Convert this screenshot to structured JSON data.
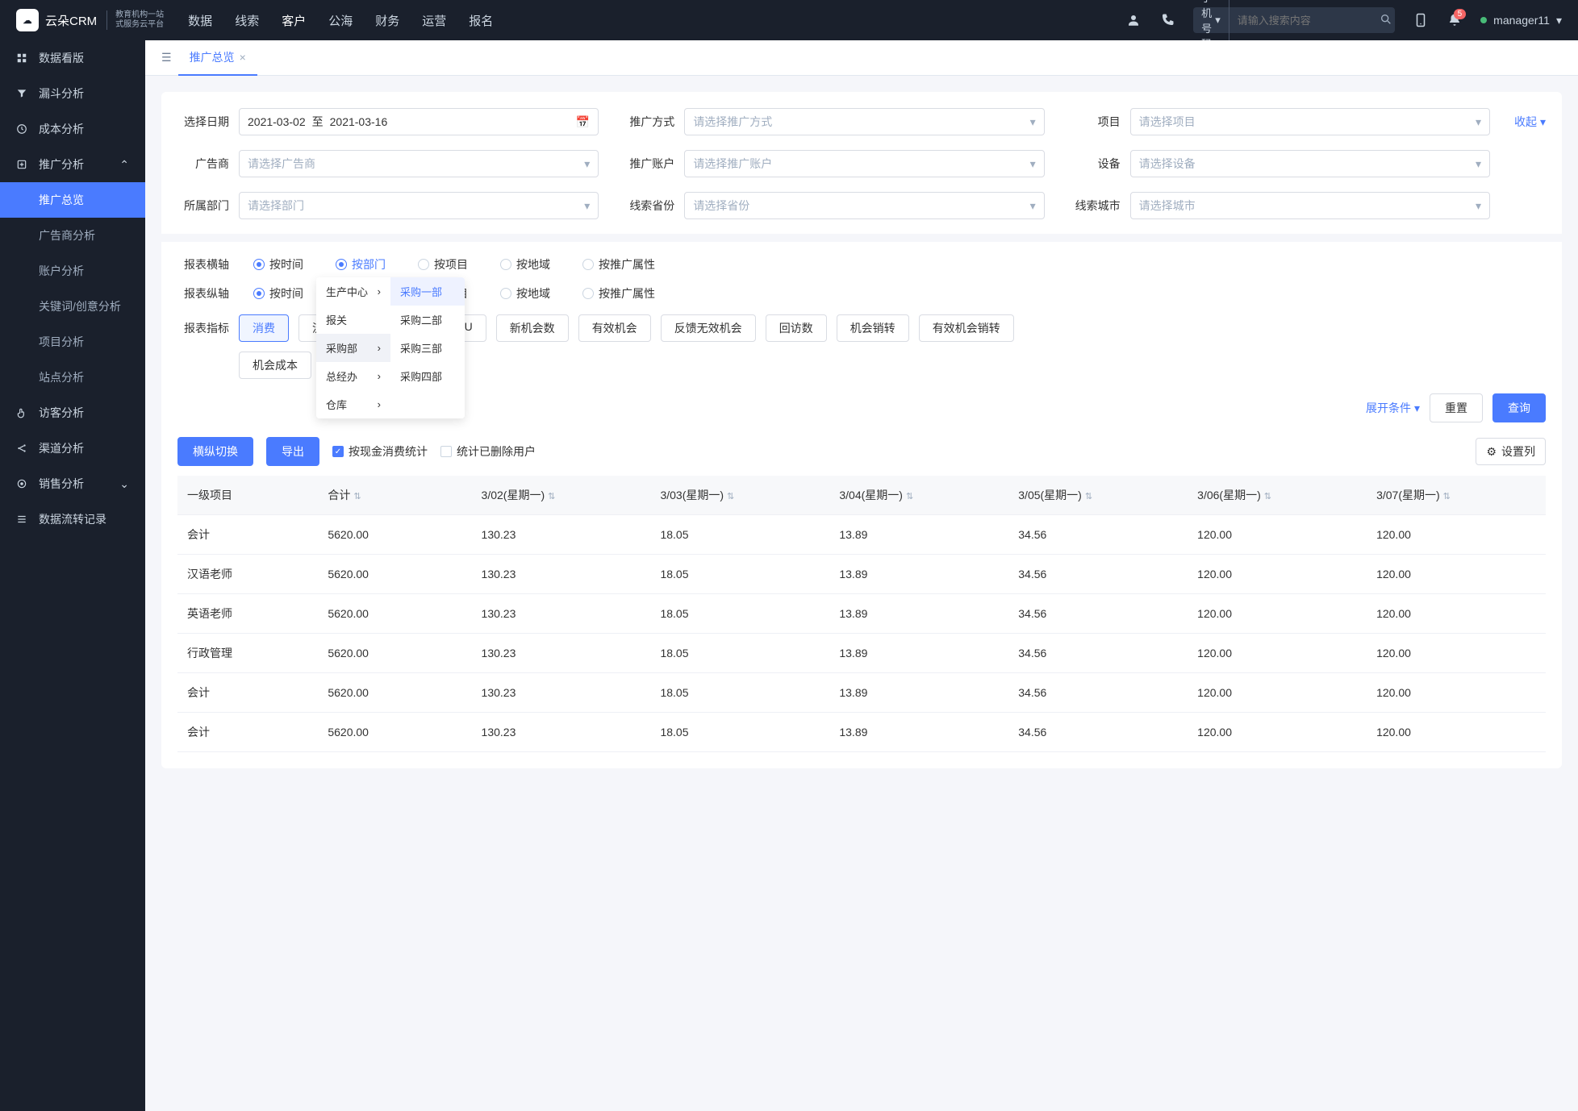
{
  "logo": {
    "brand": "云朵CRM",
    "tagline_l1": "教育机构一站",
    "tagline_l2": "式服务云平台"
  },
  "topnav": {
    "items": [
      "数据",
      "线索",
      "客户",
      "公海",
      "财务",
      "运营",
      "报名"
    ],
    "active": "客户",
    "search_type": "手机号码",
    "search_placeholder": "请输入搜索内容",
    "bell_badge": "5",
    "username": "manager11"
  },
  "sidebar": [
    {
      "icon": "grid",
      "label": "数据看版"
    },
    {
      "icon": "funnel",
      "label": "漏斗分析"
    },
    {
      "icon": "clock",
      "label": "成本分析"
    },
    {
      "icon": "share",
      "label": "推广分析",
      "expanded": true,
      "children": [
        {
          "label": "推广总览",
          "active": true
        },
        {
          "label": "广告商分析"
        },
        {
          "label": "账户分析"
        },
        {
          "label": "关键词/创意分析"
        },
        {
          "label": "项目分析"
        },
        {
          "label": "站点分析"
        }
      ]
    },
    {
      "icon": "hand",
      "label": "访客分析"
    },
    {
      "icon": "share2",
      "label": "渠道分析"
    },
    {
      "icon": "target",
      "label": "销售分析",
      "expand_icon": true
    },
    {
      "icon": "menu",
      "label": "数据流转记录"
    }
  ],
  "tab": {
    "title": "推广总览"
  },
  "filters": {
    "date_label": "选择日期",
    "date_from": "2021-03-02",
    "date_to": "2021-03-16",
    "date_sep": "至",
    "way_label": "推广方式",
    "way_placeholder": "请选择推广方式",
    "project_label": "项目",
    "project_placeholder": "请选择项目",
    "advertiser_label": "广告商",
    "advertiser_placeholder": "请选择广告商",
    "account_label": "推广账户",
    "account_placeholder": "请选择推广账户",
    "device_label": "设备",
    "device_placeholder": "请选择设备",
    "dept_label": "所属部门",
    "dept_placeholder": "请选择部门",
    "province_label": "线索省份",
    "province_placeholder": "请选择省份",
    "city_label": "线索城市",
    "city_placeholder": "请选择城市",
    "collapse": "收起"
  },
  "axis_rows": {
    "h_label": "报表横轴",
    "v_label": "报表纵轴",
    "options": [
      "按时间",
      "按部门",
      "按项目",
      "按地域",
      "按推广属性"
    ],
    "h_selected": "按时间",
    "h_hover": "按部门",
    "v_selected": "按时间"
  },
  "dept_dropdown": {
    "level1": [
      {
        "label": "生产中心",
        "arrow": true
      },
      {
        "label": "报关"
      },
      {
        "label": "采购部",
        "arrow": true,
        "hovered": true
      },
      {
        "label": "总经办",
        "arrow": true
      },
      {
        "label": "仓库",
        "arrow": true
      }
    ],
    "level2": [
      {
        "label": "采购一部",
        "sel": true
      },
      {
        "label": "采购二部"
      },
      {
        "label": "采购三部"
      },
      {
        "label": "采购四部"
      }
    ]
  },
  "metrics": {
    "label": "报表指标",
    "row1": [
      "消费",
      "流",
      "",
      "",
      "ARPU",
      "新机会数",
      "有效机会",
      "反馈无效机会",
      "回访数",
      "机会销转",
      "有效机会销转"
    ],
    "row2": [
      "机会成本",
      ""
    ],
    "selected": "消费"
  },
  "actions": {
    "expand": "展开条件",
    "reset": "重置",
    "query": "查询"
  },
  "table_toolbar": {
    "transpose": "横纵切换",
    "export": "导出",
    "cash_stat": "按现金消费统计",
    "deleted_users": "统计已删除用户",
    "set_columns": "设置列"
  },
  "table": {
    "col1": "一级项目",
    "col2": "合计",
    "date_cols": [
      "3/02(星期一)",
      "3/03(星期一)",
      "3/04(星期一)",
      "3/05(星期一)",
      "3/06(星期一)",
      "3/07(星期一)"
    ],
    "rows": [
      {
        "name": "会计",
        "total": "5620.00",
        "vals": [
          "130.23",
          "18.05",
          "13.89",
          "34.56",
          "120.00",
          "120.00"
        ]
      },
      {
        "name": "汉语老师",
        "total": "5620.00",
        "vals": [
          "130.23",
          "18.05",
          "13.89",
          "34.56",
          "120.00",
          "120.00"
        ]
      },
      {
        "name": "英语老师",
        "total": "5620.00",
        "vals": [
          "130.23",
          "18.05",
          "13.89",
          "34.56",
          "120.00",
          "120.00"
        ]
      },
      {
        "name": "行政管理",
        "total": "5620.00",
        "vals": [
          "130.23",
          "18.05",
          "13.89",
          "34.56",
          "120.00",
          "120.00"
        ]
      },
      {
        "name": "会计",
        "total": "5620.00",
        "vals": [
          "130.23",
          "18.05",
          "13.89",
          "34.56",
          "120.00",
          "120.00"
        ]
      },
      {
        "name": "会计",
        "total": "5620.00",
        "vals": [
          "130.23",
          "18.05",
          "13.89",
          "34.56",
          "120.00",
          "120.00"
        ]
      }
    ]
  }
}
